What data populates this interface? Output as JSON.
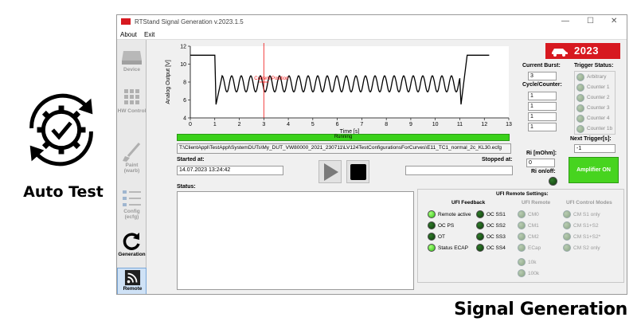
{
  "hero": {
    "label": "Auto Test",
    "icon": "gear-check-cycle-icon"
  },
  "footer": {
    "label": "Signal Generation"
  },
  "window": {
    "title": "RTStand Signal Generation v.2023.1.5",
    "controls": {
      "minimize": "—",
      "maximize": "☐",
      "close": "✕"
    }
  },
  "menu": {
    "about": "About",
    "exit": "Exit"
  },
  "sidebar": {
    "items": [
      {
        "label": "Device",
        "icon": "hard-drive-icon"
      },
      {
        "label": "HW Control",
        "icon": "grid-icon"
      },
      {
        "label": "Paint (warb)",
        "icon": "paintbrush-icon"
      },
      {
        "label": "Config (ecfg)",
        "icon": "config-list-icon"
      },
      {
        "label": "Generation",
        "icon": "refresh-icon"
      },
      {
        "label": "Remote",
        "icon": "rss-icon"
      }
    ]
  },
  "logo": {
    "year": "2023"
  },
  "chart_data": {
    "type": "line",
    "title": "",
    "xlabel": "Time [s]",
    "ylabel": "Analog Output [V]",
    "xlim": [
      0,
      13
    ],
    "ylim": [
      4,
      12
    ],
    "x_ticks": [
      "0",
      "1",
      "2",
      "3",
      "4",
      "5",
      "6",
      "7",
      "8",
      "9",
      "10",
      "11",
      "12",
      "13"
    ],
    "y_ticks": [
      "4",
      "6",
      "8",
      "10",
      "12"
    ],
    "cursor": {
      "x": 3,
      "label": "Current Position"
    },
    "series": [
      {
        "name": "",
        "x": [
          0,
          1,
          1.05,
          1.3,
          11.0,
          11.05,
          11.3,
          12.2
        ],
        "y": [
          11,
          11,
          5.5,
          8.2,
          8.2,
          5.5,
          11,
          11
        ],
        "sine": {
          "from": 1.3,
          "to": 11.0,
          "center": 7.8,
          "amplitude": 0.9,
          "period": 0.39
        }
      }
    ]
  },
  "run_status": "Running",
  "file_path": "T:\\ClientAppl\\TestAppl\\SystemDUTs\\My_DUT_VW80000_2021_230711\\LV124TestConfigurationsForCurves\\E11_TC1_normal_2c_KL30.ecfg",
  "started_label": "Started at:",
  "started_value": "14.07.2023 13:24:42",
  "stopped_label": "Stopped at:",
  "stopped_value": "",
  "status_label": "Status:",
  "current_burst": {
    "label": "Current Burst:",
    "value": "3"
  },
  "cycle_counter": {
    "label": "Cycle/Counter:",
    "values": [
      "1",
      "1",
      "1",
      "1"
    ]
  },
  "trigger_status": {
    "label": "Trigger Status:",
    "items": [
      "Arbitrary",
      "Counter 1",
      "Counter 2",
      "Counter 3",
      "Counter 4",
      "Counter 1b"
    ]
  },
  "next_trigger": {
    "label": "Next Trigger[s]:",
    "value": "-1"
  },
  "ri": {
    "label": "Ri [mOhm]:",
    "value": "0",
    "onoff_label": "Ri on/off:"
  },
  "amplifier_button": "Amplifier ON",
  "ufi": {
    "title": "UFI Remote Settings:",
    "feedback_title": "UFI Feedback",
    "feedback_left": [
      {
        "label": "Remote active",
        "state": "green"
      },
      {
        "label": "OC PS",
        "state": "dark"
      },
      {
        "label": "OT",
        "state": "dark"
      },
      {
        "label": "Status ECAP",
        "state": "green"
      }
    ],
    "feedback_right": [
      {
        "label": "OC SS1",
        "state": "dark"
      },
      {
        "label": "OC SS2",
        "state": "dark"
      },
      {
        "label": "OC SS3",
        "state": "dark"
      },
      {
        "label": "OC SS4",
        "state": "dark"
      }
    ],
    "remote_title": "UFI Remote",
    "remote_items": [
      "CM0",
      "CM1",
      "CM2",
      "ECap",
      "10k",
      "100k"
    ],
    "modes_title": "UFI Control Modes",
    "modes_items": [
      "CM S1 only",
      "CM S1+S2",
      "CM S1+S2*",
      "CM S2 only"
    ]
  }
}
